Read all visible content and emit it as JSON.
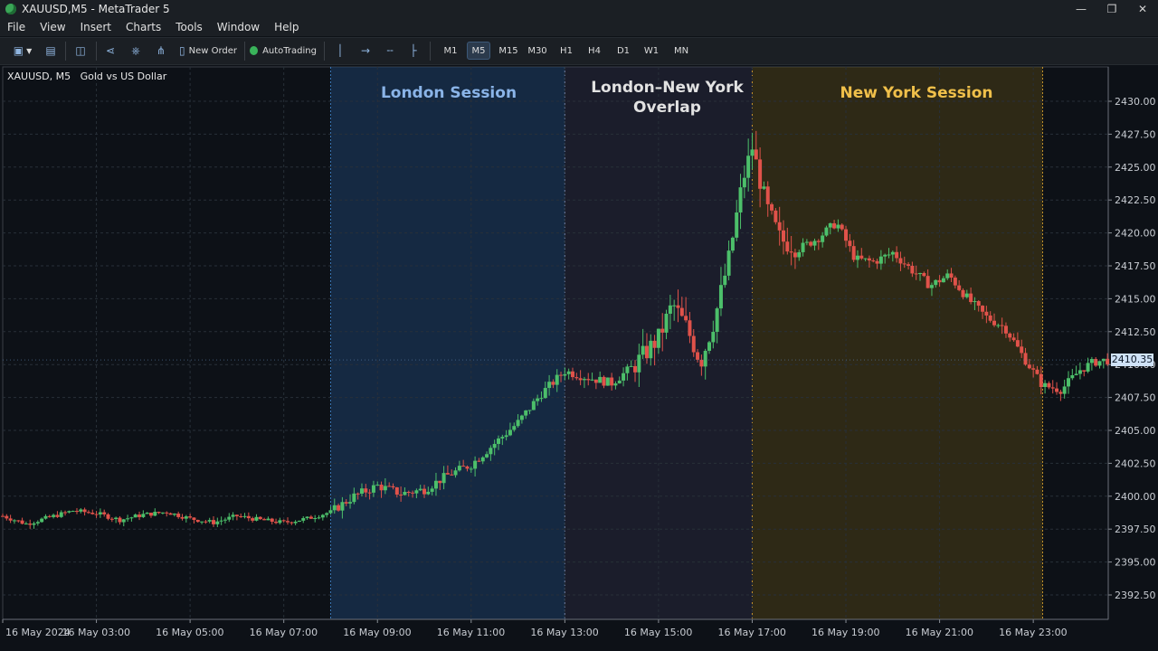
{
  "window": {
    "title": "XAUUSD,M5 - MetaTrader 5"
  },
  "menu": [
    "File",
    "View",
    "Insert",
    "Charts",
    "Tools",
    "Window",
    "Help"
  ],
  "toolbar": {
    "new_order": "New Order",
    "autotrading": "AutoTrading",
    "timeframes": [
      "M1",
      "M5",
      "M15",
      "M30",
      "H1",
      "H4",
      "D1",
      "W1",
      "MN"
    ],
    "active_timeframe": "M5"
  },
  "chart": {
    "symbol_label": "XAUUSD, M5",
    "description": "Gold vs US Dollar",
    "current_price": "2410.35",
    "sessions": [
      {
        "label": "London Session",
        "color": "#8ab4e8"
      },
      {
        "label": "London–New York Overlap",
        "color": "#e2e2e2"
      },
      {
        "label": "New York Session",
        "color": "#f0c04a"
      }
    ],
    "colors": {
      "background": "#0d1117",
      "bull": "#4cbf6a",
      "bear": "#e0524a",
      "grid": "#283039"
    }
  },
  "chart_data": {
    "type": "candlestick",
    "ylim": [
      2390,
      2432.5
    ],
    "y_ticks": [
      2392.5,
      2395.0,
      2397.5,
      2400.0,
      2402.5,
      2405.0,
      2407.5,
      2410.0,
      2412.5,
      2415.0,
      2417.5,
      2420.0,
      2422.5,
      2425.0,
      2427.5,
      2430.0
    ],
    "x_tick_labels": [
      "16 May 2024",
      "16 May 03:00",
      "16 May 05:00",
      "16 May 07:00",
      "16 May 09:00",
      "16 May 11:00",
      "16 May 13:00",
      "16 May 15:00",
      "16 May 17:00",
      "16 May 19:00",
      "16 May 21:00",
      "16 May 23:00"
    ],
    "x_tick_hours": [
      0,
      2,
      4,
      6,
      8,
      10,
      12,
      14,
      16,
      18,
      20,
      22
    ],
    "x_range_hours": [
      0,
      23.6
    ],
    "sessions_hours": [
      [
        7,
        12
      ],
      [
        12,
        16
      ],
      [
        16,
        22.2
      ]
    ],
    "close_path": [
      [
        0,
        2398.5
      ],
      [
        0.5,
        2397.9
      ],
      [
        1,
        2398.4
      ],
      [
        1.5,
        2398.9
      ],
      [
        2,
        2398.7
      ],
      [
        2.5,
        2398.2
      ],
      [
        3,
        2398.6
      ],
      [
        3.5,
        2398.8
      ],
      [
        4,
        2398.3
      ],
      [
        4.5,
        2398.0
      ],
      [
        5,
        2398.5
      ],
      [
        5.5,
        2398.2
      ],
      [
        6,
        2398.0
      ],
      [
        6.5,
        2398.3
      ],
      [
        7,
        2398.8
      ],
      [
        7.5,
        2400.0
      ],
      [
        8,
        2400.8
      ],
      [
        8.5,
        2400.2
      ],
      [
        9,
        2400.5
      ],
      [
        9.5,
        2401.6
      ],
      [
        10,
        2402.4
      ],
      [
        10.5,
        2404.0
      ],
      [
        11,
        2405.6
      ],
      [
        11.5,
        2407.8
      ],
      [
        12,
        2409.5
      ],
      [
        12.5,
        2409.0
      ],
      [
        13,
        2408.6
      ],
      [
        13.5,
        2410.0
      ],
      [
        14,
        2412.0
      ],
      [
        14.3,
        2414.6
      ],
      [
        14.6,
        2412.8
      ],
      [
        14.9,
        2410.2
      ],
      [
        15.2,
        2413.5
      ],
      [
        15.5,
        2418.0
      ],
      [
        15.8,
        2424.0
      ],
      [
        16.0,
        2426.5
      ],
      [
        16.3,
        2422.0
      ],
      [
        16.6,
        2419.5
      ],
      [
        17,
        2418.8
      ],
      [
        17.4,
        2419.6
      ],
      [
        17.8,
        2420.8
      ],
      [
        18.2,
        2418.0
      ],
      [
        18.6,
        2417.8
      ],
      [
        19,
        2418.5
      ],
      [
        19.4,
        2417.2
      ],
      [
        19.8,
        2416.0
      ],
      [
        20.2,
        2416.8
      ],
      [
        20.6,
        2415.0
      ],
      [
        21,
        2413.6
      ],
      [
        21.4,
        2412.8
      ],
      [
        21.8,
        2410.5
      ],
      [
        22.2,
        2408.4
      ],
      [
        22.6,
        2408.1
      ],
      [
        23,
        2409.6
      ],
      [
        23.3,
        2410.2
      ],
      [
        23.6,
        2410.35
      ]
    ]
  }
}
